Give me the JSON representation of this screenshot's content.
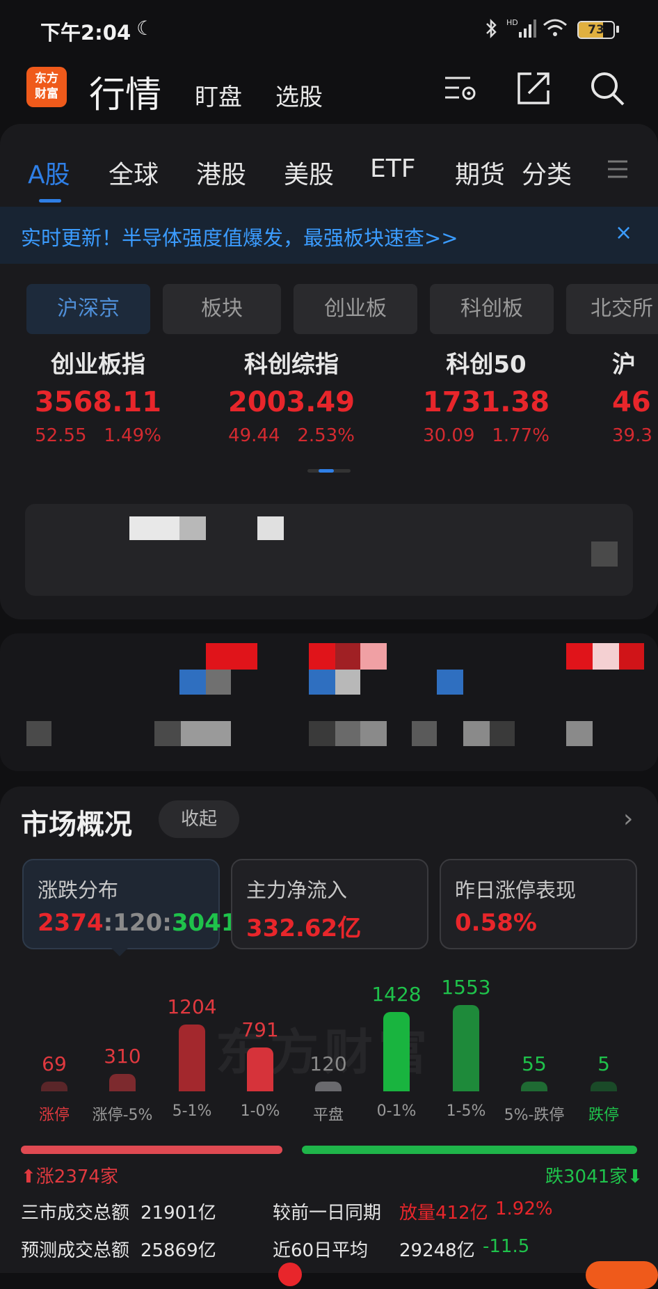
{
  "status_bar": {
    "time": "下午2:04",
    "battery": "73"
  },
  "header": {
    "logo_line1": "东方",
    "logo_line2": "财富",
    "title": "行情",
    "links": [
      "盯盘",
      "选股"
    ],
    "icons": [
      "settings-list-icon",
      "share-icon",
      "search-icon"
    ]
  },
  "tabs": [
    "A股",
    "全球",
    "港股",
    "美股",
    "ETF",
    "期货",
    "分类"
  ],
  "banner": {
    "text": "实时更新！半导体强度值爆发，最强板块速查>>",
    "close": "×"
  },
  "chips": [
    "沪深京",
    "板块",
    "创业板",
    "科创板",
    "北交所"
  ],
  "indices": [
    {
      "name": "创业板指",
      "value": "3568.11",
      "change": "52.55",
      "pct": "1.49%"
    },
    {
      "name": "科创综指",
      "value": "2003.49",
      "change": "49.44",
      "pct": "2.53%"
    },
    {
      "name": "科创50",
      "value": "1731.38",
      "change": "30.09",
      "pct": "1.77%"
    },
    {
      "name": "沪",
      "value": "46",
      "change": "39.3",
      "pct": ""
    }
  ],
  "overview": {
    "title": "市场概况",
    "collapse": "收起",
    "cards": [
      {
        "label": "涨跌分布",
        "up": "2374",
        "flat": "120",
        "down": "3041"
      },
      {
        "label": "主力净流入",
        "value": "332.62亿"
      },
      {
        "label": "昨日涨停表现",
        "value": "0.58%"
      }
    ]
  },
  "chart_data": {
    "type": "bar",
    "categories": [
      "涨停",
      "涨停-5%",
      "5-1%",
      "1-0%",
      "平盘",
      "0-1%",
      "1-5%",
      "5%-跌停",
      "跌停"
    ],
    "values": [
      69,
      310,
      1204,
      791,
      120,
      1428,
      1553,
      55,
      5
    ],
    "colors": [
      "#5a2629",
      "#7d2a2e",
      "#a3282d",
      "#d6333a",
      "#6a6a6e",
      "#19b43f",
      "#1e8a3a",
      "#1f6a33",
      "#1a4a28"
    ],
    "num_colors": [
      "#e0393f",
      "#e0393f",
      "#e0393f",
      "#e0393f",
      "#8a8a8a",
      "#1fc24b",
      "#1fc24b",
      "#1fc24b",
      "#1fc24b"
    ]
  },
  "ratio": {
    "up_label": "涨2374家",
    "down_label": "跌3041家",
    "up": 2374,
    "down": 3041
  },
  "stats": {
    "row1_label": "三市成交总额",
    "row1_value": "21901亿",
    "row1_cmp_label": "较前一日同期",
    "row1_cmp_value": "放量412亿",
    "row1_cmp_pct": "1.92%",
    "row2_label": "预测成交总额",
    "row2_value": "25869亿",
    "row2_cmp_label": "近60日平均",
    "row2_cmp_value": "29248亿",
    "row2_cmp_pct": "-11.5"
  }
}
